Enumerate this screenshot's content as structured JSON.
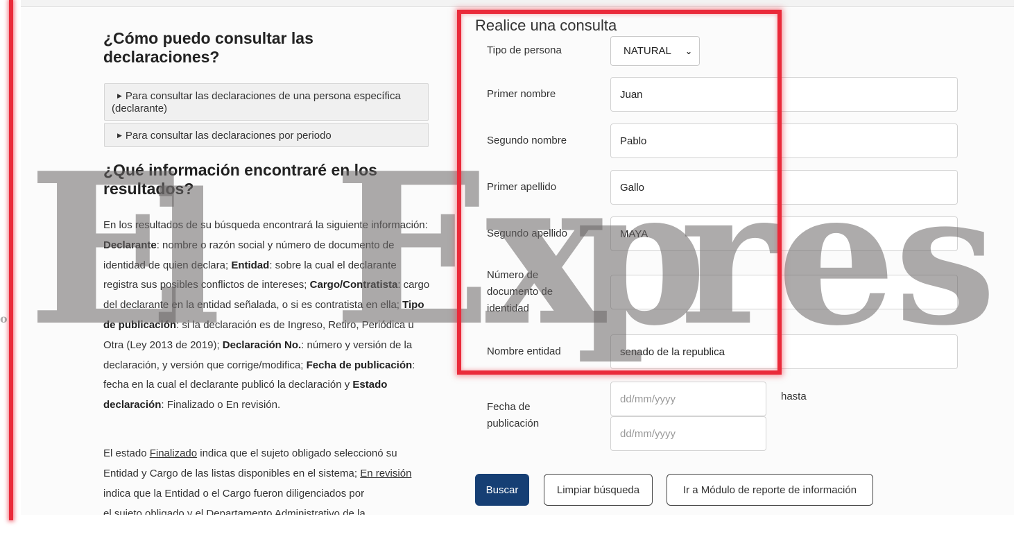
{
  "left": {
    "heading_how": "¿Cómo puedo consultar las declaraciones?",
    "accordion": [
      "Para consultar las declaraciones de una persona específica (declarante)",
      "Para consultar las declaraciones por periodo"
    ],
    "heading_what": "¿Qué información encontraré en los resultados?",
    "paragraph1": [
      {
        "t": "En los resultados de su búsqueda encontrará la siguiente información: "
      },
      {
        "b": "Declarante"
      },
      {
        "t": ": nombre o razón social y número de documento de identidad de quien declara; "
      },
      {
        "b": "Entidad"
      },
      {
        "t": ": sobre la cual el declarante registra sus posibles conflictos de intereses; "
      },
      {
        "b": "Cargo/Contratista"
      },
      {
        "t": ": cargo del declarante en la entidad señalada, o si es contratista en ella; "
      },
      {
        "b": "Tipo de publicación"
      },
      {
        "t": ": si la declaración es de Ingreso, Retiro, Periódica u Otra (Ley 2013 de 2019); "
      },
      {
        "b": "Declaración No."
      },
      {
        "t": ": número y versión de la declaración, y versión que corrige/modifica; "
      },
      {
        "b": "Fecha de publicación"
      },
      {
        "t": ": fecha en la cual el declarante publicó la declaración y "
      },
      {
        "b": "Estado declaración"
      },
      {
        "t": ": Finalizado o En revisión."
      }
    ],
    "paragraph2": [
      {
        "t": "El estado "
      },
      {
        "u": "Finalizado"
      },
      {
        "t": " indica que el sujeto obligado seleccionó su Entidad y Cargo de las listas disponibles en el sistema; "
      },
      {
        "u": "En revisión"
      },
      {
        "t": " indica que la Entidad o el Cargo fueron diligenciados por"
      }
    ],
    "paragraph2_cutoff": "el sujeto obligado y el Departamento Administrativo de la"
  },
  "form": {
    "title": "Realice una consulta",
    "tipo_persona": {
      "label": "Tipo de persona",
      "value": "NATURAL"
    },
    "primer_nombre": {
      "label": "Primer nombre",
      "value": "Juan"
    },
    "segundo_nombre": {
      "label": "Segundo nombre",
      "value": "Pablo"
    },
    "primer_apellido": {
      "label": "Primer apellido",
      "value": "Gallo"
    },
    "segundo_apellido": {
      "label": "Segundo apellido",
      "value": "MAYA"
    },
    "numero_documento": {
      "label": "Número de documento de identidad",
      "value": ""
    },
    "nombre_entidad": {
      "label": "Nombre entidad",
      "value": "senado de la republica"
    },
    "fecha_publicacion": {
      "label": "Fecha de publicación",
      "from_placeholder": "dd/mm/yyyy",
      "to_placeholder": "dd/mm/yyyy",
      "separator": "hasta"
    },
    "buttons": {
      "search": "Buscar",
      "clear": "Limpiar búsqueda",
      "module": "Ir a Módulo de reporte de información"
    }
  },
  "watermark": {
    "text": "El Expreso"
  },
  "colors": {
    "primary_button": "#163f74",
    "highlight": "#ea2a3a",
    "watermark": "#696666"
  }
}
